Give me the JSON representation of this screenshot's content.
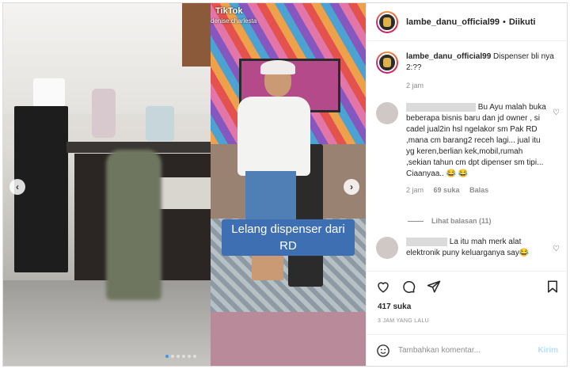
{
  "header": {
    "username": "lambe_danu_official99",
    "separator": "•",
    "follow_label": "Diikuti"
  },
  "video": {
    "tiktok_label": "TikTok",
    "tiktok_user": "denise.charlesta",
    "caption": "Lelang dispenser dari RD"
  },
  "carousel": {
    "dots": 6,
    "active_index": 0,
    "prev_arrow": "‹",
    "next_arrow": "›"
  },
  "caption_post": {
    "username": "lambe_danu_official99",
    "text": "Dispenser bli nya 2:??",
    "time": "2 jam"
  },
  "comments": [
    {
      "text": "Bu Ayu malah buka beberapa bisnis baru dan jd owner , si cadel jual2in hsl ngelakor sm Pak RD ,mana cm barang2 receh lagi... jual itu yg keren,berlian kek,mobil,rumah ,sekian tahun cm dpt dipenser sm tipi... Ciaanyaa.. 😂 😂",
      "time": "2 jam",
      "likes": "69 suka",
      "reply": "Balas",
      "view_replies": "Lihat balasan (11)"
    },
    {
      "text": "La itu mah merk alat elektronik puny keluarganya say😂"
    }
  ],
  "likes_count": "417 suka",
  "timestamp": "3 JAM YANG LALU",
  "comment_box": {
    "placeholder": "Tambahkan komentar...",
    "post_label": "Kirim"
  },
  "colors": {
    "link_blue": "#b2dffc",
    "accent": "#3797f0",
    "text": "#262626",
    "muted": "#8e8e8e"
  }
}
